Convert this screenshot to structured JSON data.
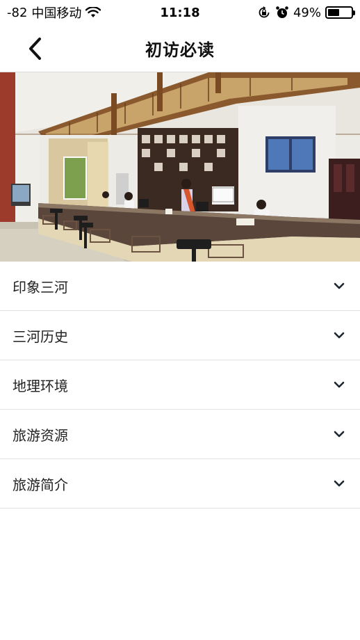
{
  "status_bar": {
    "signal": "-82",
    "carrier": "中国移动",
    "time": "11:18",
    "battery_text": "49%",
    "battery_level": 0.49
  },
  "nav": {
    "title": "初访必读",
    "back_icon": "chevron-left-icon"
  },
  "hero": {
    "image_desc_icon": "reception-hall-photo"
  },
  "menu": {
    "items": [
      {
        "label": "印象三河",
        "icon": "chevron-down-icon"
      },
      {
        "label": "三河历史",
        "icon": "chevron-down-icon"
      },
      {
        "label": "地理环境",
        "icon": "chevron-down-icon"
      },
      {
        "label": "旅游资源",
        "icon": "chevron-down-icon"
      },
      {
        "label": "旅游简介",
        "icon": "chevron-down-icon"
      }
    ]
  },
  "colors": {
    "divider": "#e2e2e2",
    "text": "#222222",
    "background": "#ffffff"
  }
}
